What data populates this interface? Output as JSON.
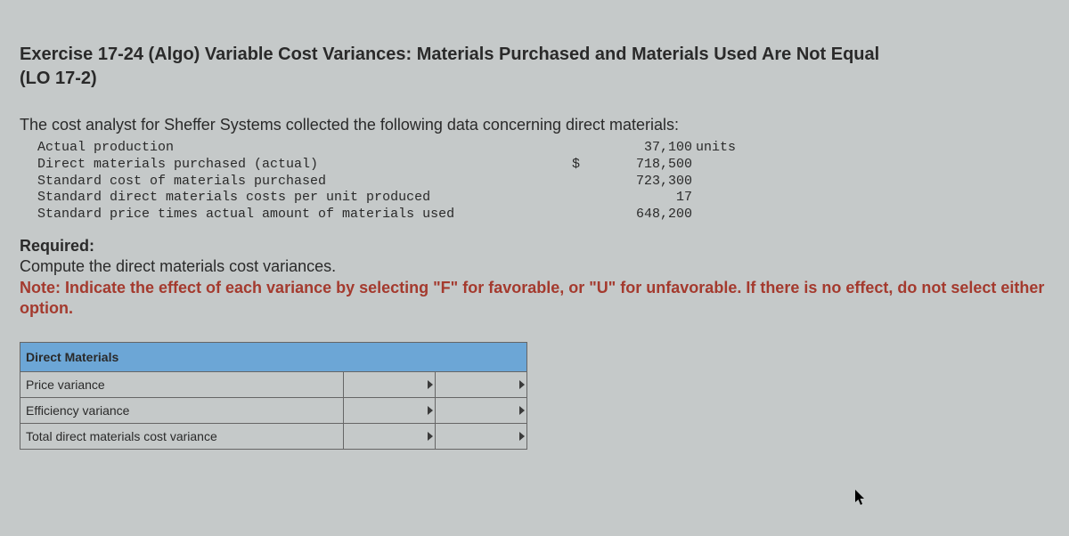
{
  "title_line1": "Exercise 17-24 (Algo) Variable Cost Variances: Materials Purchased and Materials Used Are Not Equal",
  "title_line2": "(LO 17-2)",
  "intro": "The cost analyst for Sheffer Systems collected the following data concerning direct materials:",
  "data": {
    "rows": [
      {
        "label": "Actual production",
        "currency": "",
        "value": "37,100",
        "unit": "units"
      },
      {
        "label": "Direct materials purchased (actual)",
        "currency": "$",
        "value": "718,500",
        "unit": ""
      },
      {
        "label": "Standard cost of materials purchased",
        "currency": "",
        "value": "723,300",
        "unit": ""
      },
      {
        "label": "Standard direct materials costs per unit produced",
        "currency": "",
        "value": "17",
        "unit": ""
      },
      {
        "label": "Standard price times actual amount of materials used",
        "currency": "",
        "value": "648,200",
        "unit": ""
      }
    ]
  },
  "required": {
    "heading": "Required:",
    "line1": "Compute the direct materials cost variances.",
    "note": "Note: Indicate the effect of each variance by selecting \"F\" for favorable, or \"U\" for unfavorable. If there is no effect, do not select either option."
  },
  "answer_table": {
    "header": "Direct Materials",
    "rows": [
      "Price variance",
      "Efficiency variance",
      "Total direct materials cost variance"
    ]
  }
}
